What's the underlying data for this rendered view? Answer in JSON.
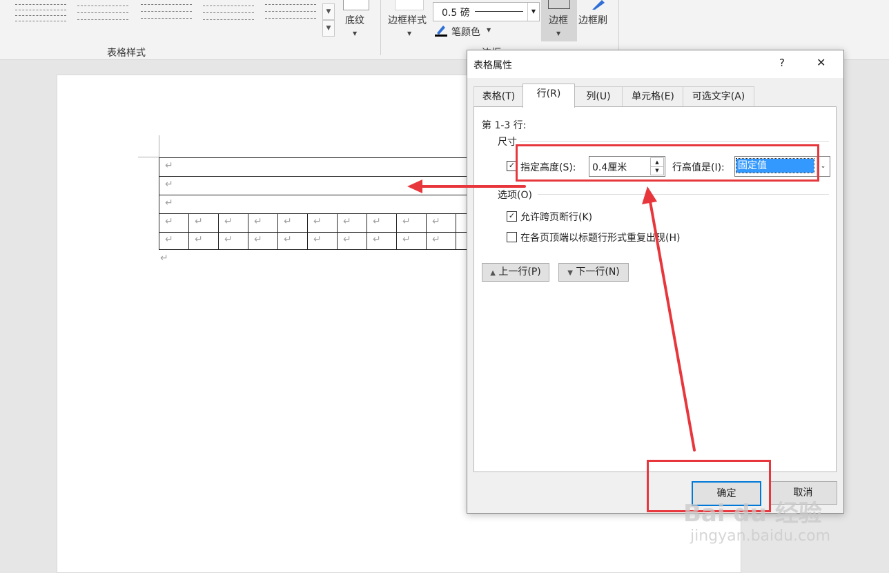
{
  "ribbon": {
    "table_styles_group": "表格样式",
    "shading_label": "底纹",
    "border_styles_label": "边框样式",
    "pen_weight": "0.5 磅",
    "pen_color_label": "笔颜色",
    "borders_label": "边框",
    "border_painter_label": "边框刷",
    "borders_group": "边框"
  },
  "document": {
    "paragraph_mark": "↵"
  },
  "dialog": {
    "title": "表格属性",
    "help": "?",
    "close": "✕",
    "tabs": [
      "表格(T)",
      "行(R)",
      "列(U)",
      "单元格(E)",
      "可选文字(A)"
    ],
    "active_tab": "行(R)",
    "rows_label": "第 1-3 行:",
    "size_group": "尺寸",
    "specify_height_label": "指定高度(S):",
    "specify_height_checked": true,
    "height_value": "0.4厘米",
    "row_height_is_label": "行高值是(I):",
    "row_height_is_value": "固定值",
    "options_group": "选项(O)",
    "allow_break_label": "允许跨页断行(K)",
    "allow_break_checked": true,
    "repeat_header_label": "在各页顶端以标题行形式重复出现(H)",
    "repeat_header_checked": false,
    "prev_row_button": "上一行(P)",
    "next_row_button": "下一行(N)",
    "ok_button": "确定",
    "cancel_button": "取消"
  },
  "watermark": {
    "brand": "Bai du 经验",
    "url": "jingyan.baidu.com"
  },
  "colors": {
    "annotation_red": "#e8373c",
    "selection_blue": "#3399ff",
    "focus_blue": "#0078d7"
  }
}
